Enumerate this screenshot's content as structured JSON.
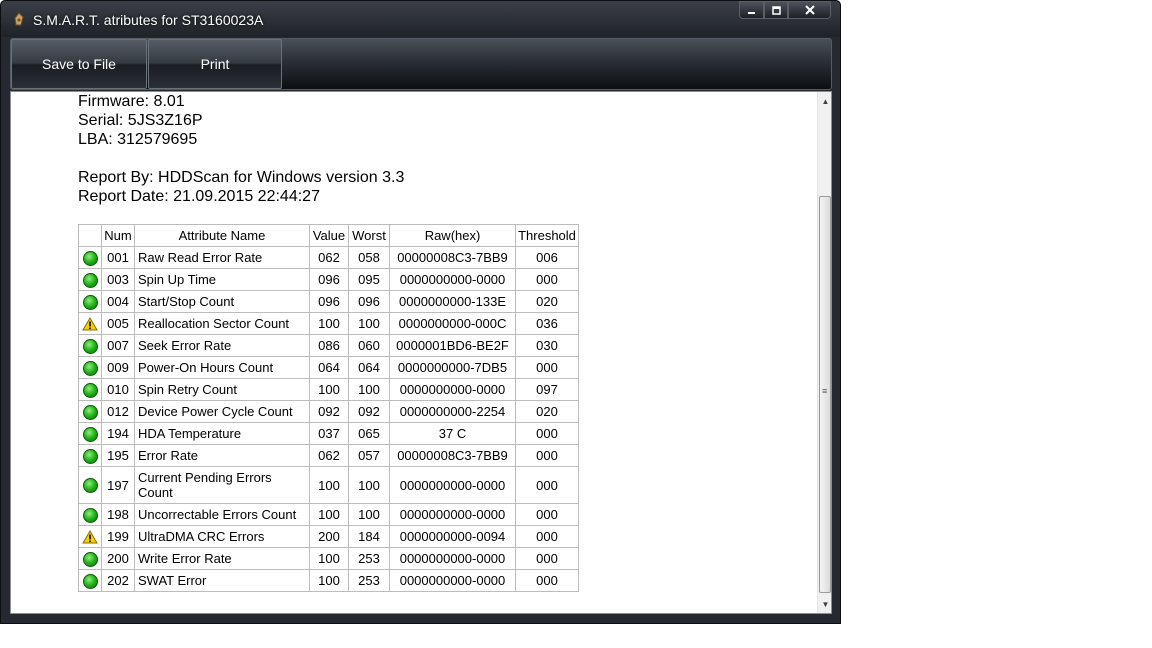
{
  "window": {
    "title": "S.M.A.R.T. atributes for ST3160023A",
    "icon": "hdd-app-icon"
  },
  "toolbar": {
    "save_label": "Save to File",
    "print_label": "Print"
  },
  "info": {
    "firmware": "Firmware: 8.01",
    "serial": "Serial: 5JS3Z16P",
    "lba": "LBA: 312579695",
    "report_by": "Report By: HDDScan for Windows version 3.3",
    "report_date": "Report Date: 21.09.2015 22:44:27"
  },
  "table": {
    "headers": [
      "",
      "Num",
      "Attribute Name",
      "Value",
      "Worst",
      "Raw(hex)",
      "Threshold"
    ],
    "rows": [
      {
        "status": "ok",
        "num": "001",
        "name": "Raw Read Error Rate",
        "value": "062",
        "worst": "058",
        "raw": "00000008C3-7BB9",
        "threshold": "006"
      },
      {
        "status": "ok",
        "num": "003",
        "name": "Spin Up Time",
        "value": "096",
        "worst": "095",
        "raw": "0000000000-0000",
        "threshold": "000"
      },
      {
        "status": "ok",
        "num": "004",
        "name": "Start/Stop Count",
        "value": "096",
        "worst": "096",
        "raw": "0000000000-133E",
        "threshold": "020"
      },
      {
        "status": "warning",
        "num": "005",
        "name": "Reallocation Sector Count",
        "value": "100",
        "worst": "100",
        "raw": "0000000000-000C",
        "threshold": "036"
      },
      {
        "status": "ok",
        "num": "007",
        "name": "Seek Error Rate",
        "value": "086",
        "worst": "060",
        "raw": "0000001BD6-BE2F",
        "threshold": "030"
      },
      {
        "status": "ok",
        "num": "009",
        "name": "Power-On Hours Count",
        "value": "064",
        "worst": "064",
        "raw": "0000000000-7DB5",
        "threshold": "000"
      },
      {
        "status": "ok",
        "num": "010",
        "name": "Spin Retry Count",
        "value": "100",
        "worst": "100",
        "raw": "0000000000-0000",
        "threshold": "097"
      },
      {
        "status": "ok",
        "num": "012",
        "name": "Device Power Cycle Count",
        "value": "092",
        "worst": "092",
        "raw": "0000000000-2254",
        "threshold": "020"
      },
      {
        "status": "ok",
        "num": "194",
        "name": "HDA Temperature",
        "value": "037",
        "worst": "065",
        "raw": "37 C",
        "threshold": "000"
      },
      {
        "status": "ok",
        "num": "195",
        "name": "Error Rate",
        "value": "062",
        "worst": "057",
        "raw": "00000008C3-7BB9",
        "threshold": "000"
      },
      {
        "status": "ok",
        "num": "197",
        "name": "Current Pending Errors Count",
        "value": "100",
        "worst": "100",
        "raw": "0000000000-0000",
        "threshold": "000"
      },
      {
        "status": "ok",
        "num": "198",
        "name": "Uncorrectable Errors Count",
        "value": "100",
        "worst": "100",
        "raw": "0000000000-0000",
        "threshold": "000"
      },
      {
        "status": "warning",
        "num": "199",
        "name": "UltraDMA CRC Errors",
        "value": "200",
        "worst": "184",
        "raw": "0000000000-0094",
        "threshold": "000"
      },
      {
        "status": "ok",
        "num": "200",
        "name": "Write Error Rate",
        "value": "100",
        "worst": "253",
        "raw": "0000000000-0000",
        "threshold": "000"
      },
      {
        "status": "ok",
        "num": "202",
        "name": "SWAT Error",
        "value": "100",
        "worst": "253",
        "raw": "0000000000-0000",
        "threshold": "000"
      }
    ]
  },
  "colors": {
    "ok": "#22b11a",
    "warning": "#f5d000"
  }
}
